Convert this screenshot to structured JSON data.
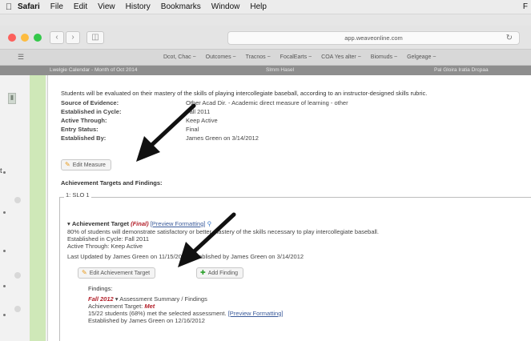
{
  "menubar": {
    "app": "Safari",
    "items": [
      "File",
      "Edit",
      "View",
      "History",
      "Bookmarks",
      "Window",
      "Help"
    ],
    "right": "F"
  },
  "window": {
    "title": ""
  },
  "browser": {
    "url": "app.weaveonline.com"
  },
  "appnav": {
    "items": [
      "Dcot, Chac ~",
      "Outcomes ~",
      "Tracnos ~",
      "FocalEarts ~",
      "COA Yes alter ~",
      "Biomuds ~",
      "Gelgeage ~"
    ]
  },
  "pagetabs": {
    "left": "Lwelgie Calendar - Month of Oct 2014",
    "mid": "Slmm Hasel",
    "right": "Pal Gloira Iratia Drcpaa"
  },
  "measure": {
    "intro": "Students will be evaluated on their mastery of the skills of playing intercollegiate baseball, according to an instructor-designed skills rubric.",
    "fields": [
      {
        "label": "Source of Evidence:",
        "value": "Other Acad Dir. - Academic direct measure of learning - other"
      },
      {
        "label": "Established in Cycle:",
        "value": "Fall 2011"
      },
      {
        "label": "Active Through:",
        "value": "Keep Active"
      },
      {
        "label": "Entry Status:",
        "value": "Final"
      },
      {
        "label": "Established By:",
        "value": "James Green on 3/14/2012"
      }
    ],
    "edit_button": "Edit Measure"
  },
  "achievement": {
    "heading": "Achievement Targets and Findings:",
    "slo_label": "1: SLO 1",
    "target_prefix": "Achievement Target",
    "target_status": "(Final)",
    "preview_link": "[Preview Formatting]",
    "lines": [
      "80% of students will demonstrate satisfactory or better mastery of the skills necessary to play intercollegiate baseball.",
      "Established in Cycle: Fall 2011",
      "Active Through: Keep Active",
      "Last Updated by James Green on 11/15/2012 Established by James Green on 3/14/2012"
    ],
    "edit_target_button": "Edit Achievement Target",
    "add_finding_button": "Add Finding",
    "findings_label": "Findings:",
    "finding_cycle": "Fall 2012",
    "finding_title": "Assessment Summary / Findings",
    "finding_target_label": "Achievement Target:",
    "finding_target_value": "Met",
    "finding_detail": "15/22 students (68%) met the selected assessment.",
    "finding_preview_link": "[Preview Formatting]",
    "finding_established": "Established by James Green on 12/16/2012"
  },
  "edge_text": "t"
}
